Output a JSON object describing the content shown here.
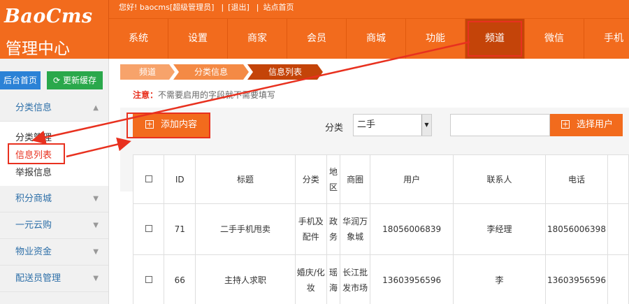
{
  "brand": {
    "logo": "BaoCms",
    "subtitle": "管理中心"
  },
  "topbar": {
    "greeting": "您好! baocms[超级管理员]",
    "logout": "[退出]",
    "homepage": "站点首页"
  },
  "nav": {
    "items": [
      {
        "label": "系统"
      },
      {
        "label": "设置"
      },
      {
        "label": "商家"
      },
      {
        "label": "会员"
      },
      {
        "label": "商城"
      },
      {
        "label": "功能"
      },
      {
        "label": "频道",
        "active": true
      },
      {
        "label": "微信"
      },
      {
        "label": "手机"
      }
    ]
  },
  "sidebar": {
    "home_button": "后台首页",
    "refresh_button": "更新缓存",
    "current_group": "分类信息",
    "sub_items": [
      "分类管理",
      "信息列表",
      "举报信息"
    ],
    "groups": [
      "积分商城",
      "一元云购",
      "物业资金",
      "配送员管理"
    ]
  },
  "breadcrumb": [
    "频道",
    "分类信息",
    "信息列表"
  ],
  "notice": {
    "label": "注意：",
    "text": "不需要启用的字段就不需要填写"
  },
  "toolbar": {
    "add_button": "添加内容",
    "category_label": "分类",
    "category_value": "二手",
    "select_user_button": "选择用户"
  },
  "table": {
    "columns": [
      "",
      "ID",
      "标题",
      "分类",
      "地区",
      "商圈",
      "用户",
      "联系人",
      "电话"
    ],
    "rows": [
      {
        "id": "71",
        "title": "二手手机甩卖",
        "category": "手机及配件",
        "area": "政务",
        "district": "华润万象城",
        "user": "18056006839",
        "contact": "李经理",
        "phone": "18056006398"
      },
      {
        "id": "66",
        "title": "主持人求职",
        "category": "婚庆/化妆",
        "area": "瑶海",
        "district": "长江批发市场",
        "user": "13603956596",
        "contact": "李",
        "phone": "13603956596"
      }
    ]
  },
  "colors": {
    "brand_orange": "#f26b1d",
    "nav_active": "#c44409",
    "annotation_red": "#e8311f",
    "home_button_blue": "#2b82d6",
    "refresh_button_green": "#2aa84b"
  }
}
